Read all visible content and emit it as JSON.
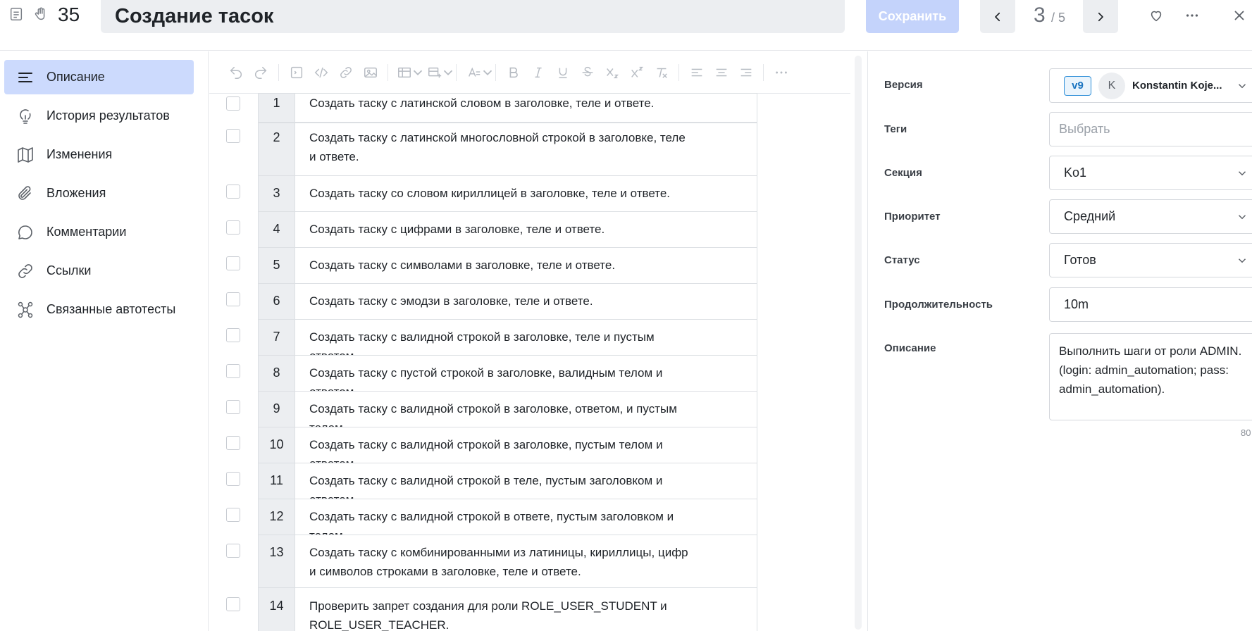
{
  "header": {
    "task_number": "35",
    "title": "Создание тасок",
    "save_label": "Сохранить",
    "pager_current": "3",
    "pager_total": "/ 5"
  },
  "sidebar": {
    "items": [
      {
        "label": "Описание",
        "icon": "lines-icon",
        "active": true
      },
      {
        "label": "История результатов",
        "icon": "lightbulb-icon",
        "active": false
      },
      {
        "label": "Изменения",
        "icon": "map-icon",
        "active": false
      },
      {
        "label": "Вложения",
        "icon": "paperclip-icon",
        "active": false
      },
      {
        "label": "Комментарии",
        "icon": "chat-icon",
        "active": false
      },
      {
        "label": "Ссылки",
        "icon": "link-icon",
        "active": false
      },
      {
        "label": "Связанные автотесты",
        "icon": "nodes-icon",
        "active": false
      }
    ]
  },
  "steps": [
    {
      "num": "1",
      "text": "Создать таску с латинской словом в заголовке, теле и ответе."
    },
    {
      "num": "2",
      "text": "Создать таску с латинской многословной строкой в заголовке, теле и ответе."
    },
    {
      "num": "3",
      "text": "Создать таску со словом кириллицей в заголовке, теле и ответе."
    },
    {
      "num": "4",
      "text": "Создать таску с цифрами в заголовке, теле и ответе."
    },
    {
      "num": "5",
      "text": "Создать таску с символами в заголовке, теле и ответе."
    },
    {
      "num": "6",
      "text": "Создать таску с эмодзи в заголовке, теле и ответе."
    },
    {
      "num": "7",
      "text": "Создать таску с валидной строкой в заголовке, теле и пустым ответом."
    },
    {
      "num": "8",
      "text": "Создать таску с пустой строкой в заголовке, валидным телом и ответом."
    },
    {
      "num": "9",
      "text": "Создать таску с валидной строкой в заголовке, ответом, и пустым телом."
    },
    {
      "num": "10",
      "text": "Создать таску с валидной строкой в заголовке, пустым телом и ответом."
    },
    {
      "num": "11",
      "text": "Создать таску с валидной строкой в теле, пустым заголовком и ответом."
    },
    {
      "num": "12",
      "text": "Создать таску с валидной строкой в ответе, пустым заголовком и телом."
    },
    {
      "num": "13",
      "text": "Создать таску с комбинированными из латиницы, кириллицы, цифр и символов строками в заголовке, теле и ответе."
    },
    {
      "num": "14",
      "text": "Проверить запрет создания для роли ROLE_USER_STUDENT и ROLE_USER_TEACHER."
    }
  ],
  "fields": {
    "version_label": "Версия",
    "version_badge": "v9",
    "version_avatar": "K",
    "version_user": "Konstantin Koje...",
    "tags_label": "Теги",
    "tags_placeholder": "Выбрать",
    "section_label": "Секция",
    "section_value": "Ko1",
    "priority_label": "Приоритет",
    "priority_value": "Средний",
    "status_label": "Статус",
    "status_value": "Готов",
    "duration_label": "Продолжительность",
    "duration_value": "10m",
    "description_label": "Описание",
    "description_value": "Выполнить шаги от роли ADMIN. (login: admin_automation; pass: admin_automation).",
    "char_count": "80"
  },
  "colors": {
    "accent_active": "#ccdafd",
    "save_button": "#c4d3fb",
    "version_badge": "#2f8fd8"
  }
}
